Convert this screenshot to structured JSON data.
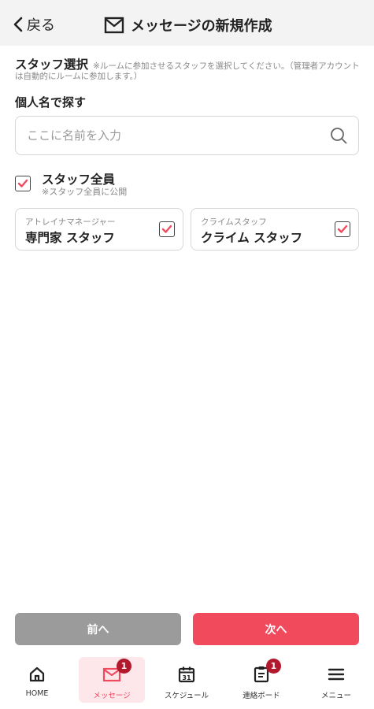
{
  "header": {
    "back_label": "戻る",
    "title": "メッセージの新規作成"
  },
  "staff_select": {
    "label": "スタッフ選択",
    "note": "※ルームに参加させるスタッフを選択してください。（管理者アカウントは自動的にルームに参加します。）"
  },
  "search": {
    "heading": "個人名で探す",
    "placeholder": "ここに名前を入力",
    "value": ""
  },
  "all_staff": {
    "label": "スタッフ全員",
    "note": "※スタッフ全員に公開",
    "checked": true
  },
  "staff_cards": [
    {
      "role": "アトレイナマネージャー",
      "name": "専門家 スタッフ",
      "checked": true
    },
    {
      "role": "クライムスタッフ",
      "name": "クライム スタッフ",
      "checked": true
    }
  ],
  "buttons": {
    "prev_label": "前へ",
    "next_label": "次へ"
  },
  "tabs": [
    {
      "label": "HOME",
      "icon": "home-icon",
      "badge": "",
      "active": false
    },
    {
      "label": "メッセージ",
      "icon": "mail-icon",
      "badge": "1",
      "active": true
    },
    {
      "label": "スケジュール",
      "icon": "calendar-icon",
      "badge": "",
      "active": false,
      "icon_text": "31"
    },
    {
      "label": "連絡ボード",
      "icon": "clipboard-icon",
      "badge": "1",
      "active": false
    },
    {
      "label": "メニュー",
      "icon": "hamburger-icon",
      "badge": "",
      "active": false
    }
  ],
  "colors": {
    "accent": "#f24a5d",
    "badge": "#b3192d",
    "button_disabled": "#9b9b9b",
    "header_bg": "#f3f3f3",
    "active_tab_bg": "#fde7ea"
  }
}
